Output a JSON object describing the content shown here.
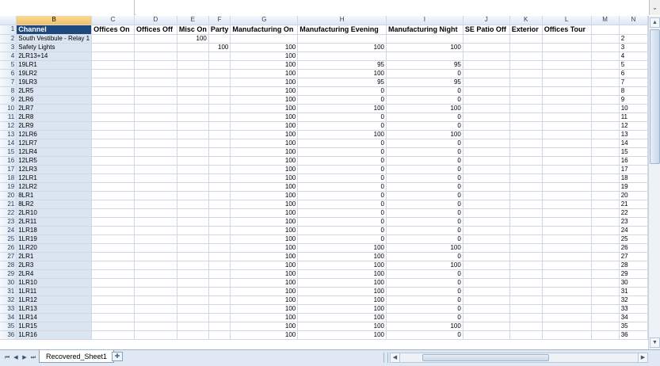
{
  "formula_bar": {
    "name_box": "",
    "formula": ""
  },
  "columns": [
    "B",
    "C",
    "D",
    "E",
    "F",
    "G",
    "H",
    "I",
    "J",
    "K",
    "L",
    "M",
    "N"
  ],
  "header_row": {
    "row_num": "1",
    "cells": [
      "Channel",
      "Offices On",
      "Offices Off",
      "Misc On",
      "Party",
      "Manufacturing On",
      "Manufacturing Evening",
      "Manufacturing Night",
      "SE Patio Off",
      "Exterior",
      "Offices Tour",
      "",
      ""
    ]
  },
  "rows": [
    {
      "n": "2",
      "b": "South Vestibule - Relay 1",
      "e": "100",
      "f": "",
      "g": "",
      "h": "",
      "i": ""
    },
    {
      "n": "3",
      "b": "Safety Lights",
      "e": "",
      "f": "100",
      "g": "100",
      "h": "100",
      "i": "100"
    },
    {
      "n": "4",
      "b": "2LR13+14",
      "e": "",
      "f": "",
      "g": "100",
      "h": "",
      "i": ""
    },
    {
      "n": "5",
      "b": "19LR1",
      "e": "",
      "f": "",
      "g": "100",
      "h": "95",
      "i": "95"
    },
    {
      "n": "6",
      "b": "19LR2",
      "e": "",
      "f": "",
      "g": "100",
      "h": "100",
      "i": "0"
    },
    {
      "n": "7",
      "b": "19LR3",
      "e": "",
      "f": "",
      "g": "100",
      "h": "95",
      "i": "95"
    },
    {
      "n": "8",
      "b": "2LR5",
      "e": "",
      "f": "",
      "g": "100",
      "h": "0",
      "i": "0"
    },
    {
      "n": "9",
      "b": "2LR6",
      "e": "",
      "f": "",
      "g": "100",
      "h": "0",
      "i": "0"
    },
    {
      "n": "10",
      "b": "2LR7",
      "e": "",
      "f": "",
      "g": "100",
      "h": "100",
      "i": "100"
    },
    {
      "n": "11",
      "b": "2LR8",
      "e": "",
      "f": "",
      "g": "100",
      "h": "0",
      "i": "0"
    },
    {
      "n": "12",
      "b": "2LR9",
      "e": "",
      "f": "",
      "g": "100",
      "h": "0",
      "i": "0"
    },
    {
      "n": "13",
      "b": "12LR6",
      "e": "",
      "f": "",
      "g": "100",
      "h": "100",
      "i": "100"
    },
    {
      "n": "14",
      "b": "12LR7",
      "e": "",
      "f": "",
      "g": "100",
      "h": "0",
      "i": "0"
    },
    {
      "n": "15",
      "b": "12LR4",
      "e": "",
      "f": "",
      "g": "100",
      "h": "0",
      "i": "0"
    },
    {
      "n": "16",
      "b": "12LR5",
      "e": "",
      "f": "",
      "g": "100",
      "h": "0",
      "i": "0"
    },
    {
      "n": "17",
      "b": "12LR3",
      "e": "",
      "f": "",
      "g": "100",
      "h": "0",
      "i": "0"
    },
    {
      "n": "18",
      "b": "12LR1",
      "e": "",
      "f": "",
      "g": "100",
      "h": "0",
      "i": "0"
    },
    {
      "n": "19",
      "b": "12LR2",
      "e": "",
      "f": "",
      "g": "100",
      "h": "0",
      "i": "0"
    },
    {
      "n": "20",
      "b": "8LR1",
      "e": "",
      "f": "",
      "g": "100",
      "h": "0",
      "i": "0"
    },
    {
      "n": "21",
      "b": "8LR2",
      "e": "",
      "f": "",
      "g": "100",
      "h": "0",
      "i": "0"
    },
    {
      "n": "22",
      "b": "2LR10",
      "e": "",
      "f": "",
      "g": "100",
      "h": "0",
      "i": "0"
    },
    {
      "n": "23",
      "b": "2LR11",
      "e": "",
      "f": "",
      "g": "100",
      "h": "0",
      "i": "0"
    },
    {
      "n": "24",
      "b": "1LR18",
      "e": "",
      "f": "",
      "g": "100",
      "h": "0",
      "i": "0"
    },
    {
      "n": "25",
      "b": "1LR19",
      "e": "",
      "f": "",
      "g": "100",
      "h": "0",
      "i": "0"
    },
    {
      "n": "26",
      "b": "1LR20",
      "e": "",
      "f": "",
      "g": "100",
      "h": "100",
      "i": "100"
    },
    {
      "n": "27",
      "b": "2LR1",
      "e": "",
      "f": "",
      "g": "100",
      "h": "100",
      "i": "0"
    },
    {
      "n": "28",
      "b": "2LR3",
      "e": "",
      "f": "",
      "g": "100",
      "h": "100",
      "i": "100"
    },
    {
      "n": "29",
      "b": "2LR4",
      "e": "",
      "f": "",
      "g": "100",
      "h": "100",
      "i": "0"
    },
    {
      "n": "30",
      "b": "1LR10",
      "e": "",
      "f": "",
      "g": "100",
      "h": "100",
      "i": "0"
    },
    {
      "n": "31",
      "b": "1LR11",
      "e": "",
      "f": "",
      "g": "100",
      "h": "100",
      "i": "0"
    },
    {
      "n": "32",
      "b": "1LR12",
      "e": "",
      "f": "",
      "g": "100",
      "h": "100",
      "i": "0"
    },
    {
      "n": "33",
      "b": "1LR13",
      "e": "",
      "f": "",
      "g": "100",
      "h": "100",
      "i": "0"
    },
    {
      "n": "34",
      "b": "1LR14",
      "e": "",
      "f": "",
      "g": "100",
      "h": "100",
      "i": "0"
    },
    {
      "n": "35",
      "b": "1LR15",
      "e": "",
      "f": "",
      "g": "100",
      "h": "100",
      "i": "100"
    },
    {
      "n": "36",
      "b": "1LR16",
      "e": "",
      "f": "",
      "g": "100",
      "h": "100",
      "i": "0"
    }
  ],
  "sheet_tabs": {
    "active": "Recovered_Sheet1"
  },
  "nav_icons": [
    "first-sheet-icon",
    "prev-sheet-icon",
    "next-sheet-icon",
    "last-sheet-icon"
  ],
  "colors": {
    "header_fill": "#1f497d",
    "selected_column": "#dbe5f1",
    "selected_header": "#f1c15f"
  }
}
